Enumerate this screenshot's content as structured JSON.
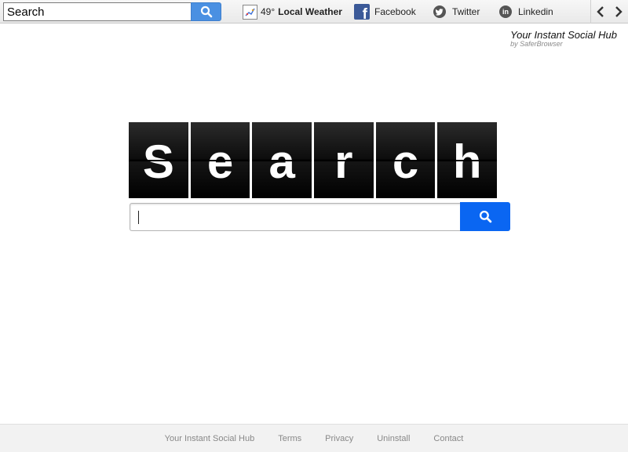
{
  "toolbar": {
    "search": {
      "value": "Search"
    },
    "weather": {
      "temperature": "49°",
      "label": "Local Weather"
    },
    "links": {
      "facebook": "Facebook",
      "twitter": "Twitter",
      "linkedin": "Linkedin"
    }
  },
  "brand": {
    "title": "Your Instant Social Hub",
    "subtitle": "by SaferBrowser"
  },
  "logo": {
    "letters": [
      "S",
      "e",
      "a",
      "r",
      "c",
      "h"
    ]
  },
  "main_search": {
    "value": ""
  },
  "footer": {
    "links": [
      "Your Instant Social Hub",
      "Terms",
      "Privacy",
      "Uninstall",
      "Contact"
    ]
  },
  "colors": {
    "toolbar_search_button": "#4a90e2",
    "main_search_button": "#0a66f2",
    "facebook": "#3b5998",
    "footer_bg": "#f2f2f2"
  }
}
